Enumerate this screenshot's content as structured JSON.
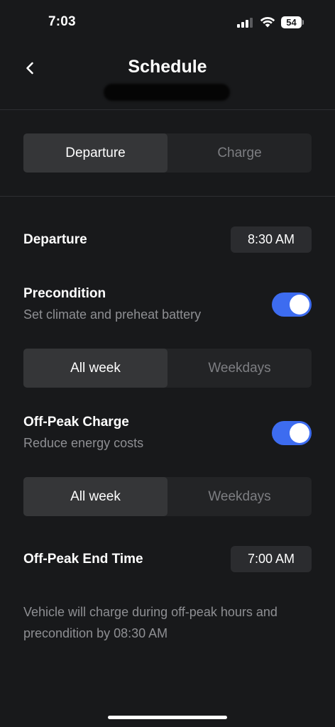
{
  "status_bar": {
    "time": "7:03",
    "battery_level": "54",
    "signal_bars_active": 3,
    "signal_bars_total": 4
  },
  "header": {
    "title": "Schedule",
    "back_icon": "chevron-left-icon"
  },
  "mode_tabs": {
    "items": [
      {
        "label": "Departure",
        "active": true
      },
      {
        "label": "Charge",
        "active": false
      }
    ]
  },
  "departure": {
    "label": "Departure",
    "time": "8:30 AM"
  },
  "precondition": {
    "label": "Precondition",
    "description": "Set climate and preheat battery",
    "enabled": true,
    "days": [
      {
        "label": "All week",
        "active": true
      },
      {
        "label": "Weekdays",
        "active": false
      }
    ]
  },
  "off_peak": {
    "label": "Off-Peak Charge",
    "description": "Reduce energy costs",
    "enabled": true,
    "days": [
      {
        "label": "All week",
        "active": true
      },
      {
        "label": "Weekdays",
        "active": false
      }
    ]
  },
  "off_peak_end": {
    "label": "Off-Peak End Time",
    "time": "7:00 AM"
  },
  "footnote": "Vehicle will charge during off-peak hours and precondition by 08:30 AM",
  "colors": {
    "background": "#18191b",
    "toggle_on": "#3d6cf0",
    "segment_active": "#353638",
    "segment_track": "#232426"
  }
}
